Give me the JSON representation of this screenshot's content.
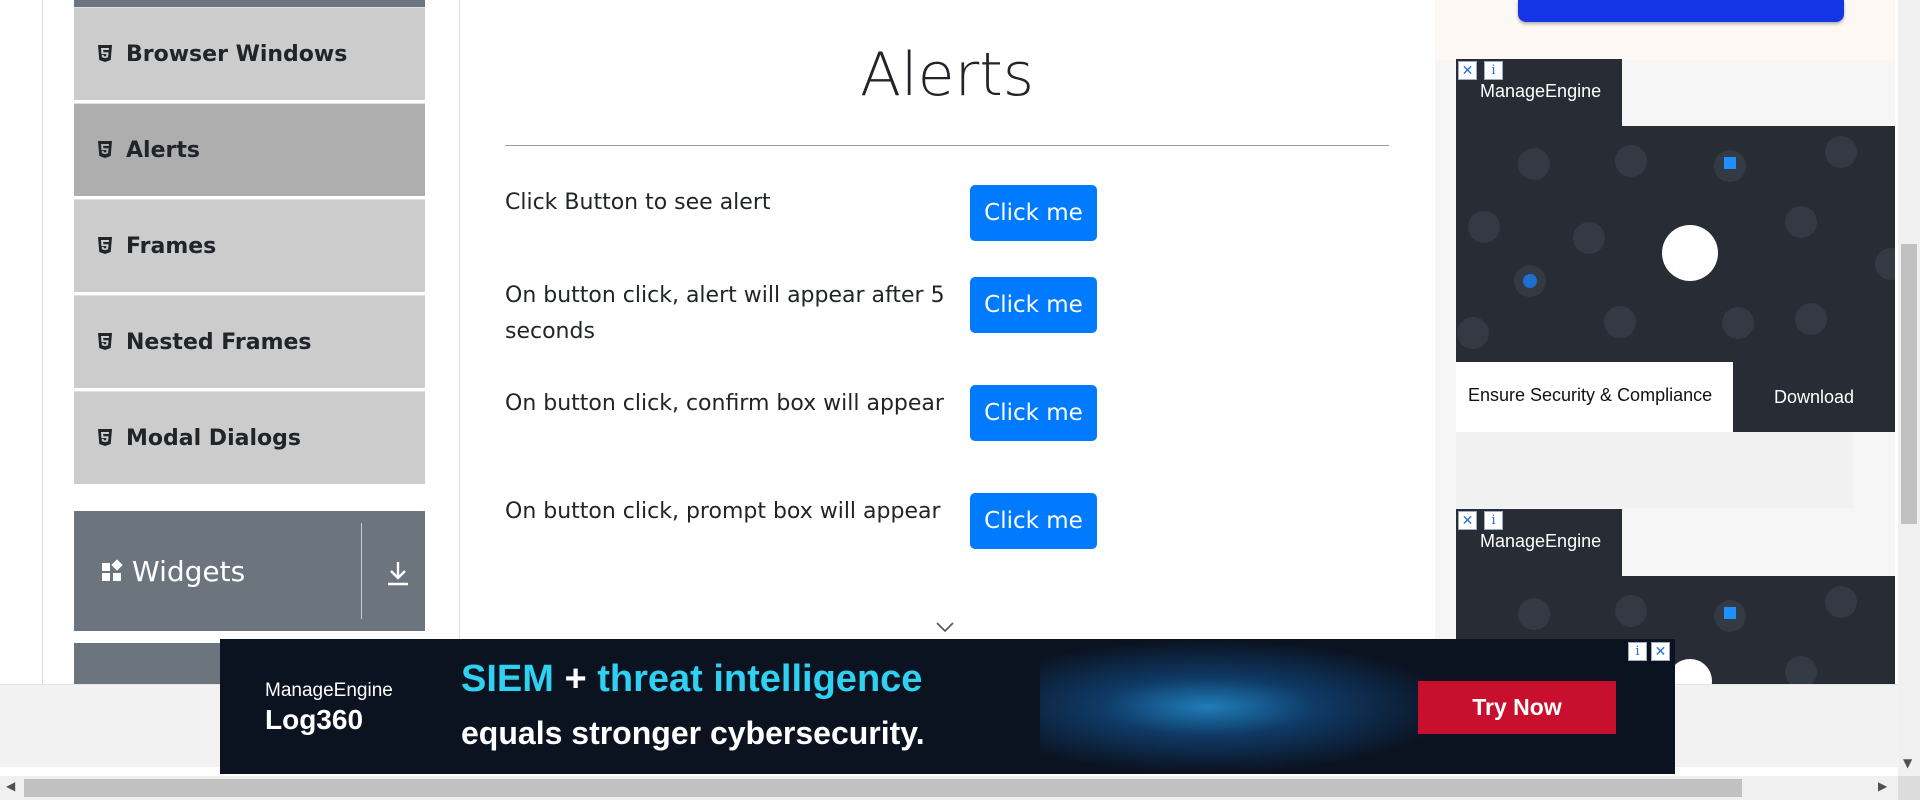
{
  "sidebar": {
    "items": [
      {
        "label": "Browser Windows",
        "icon": "html5-icon",
        "active": false
      },
      {
        "label": "Alerts",
        "icon": "html5-icon",
        "active": true
      },
      {
        "label": "Frames",
        "icon": "html5-icon",
        "active": false
      },
      {
        "label": "Nested Frames",
        "icon": "html5-icon",
        "active": false
      },
      {
        "label": "Modal Dialogs",
        "icon": "html5-icon",
        "active": false
      }
    ],
    "group": {
      "label": "Widgets",
      "icon": "widgets-grid-icon",
      "toggle_icon": "download-arrow-icon"
    }
  },
  "main": {
    "title": "Alerts",
    "rows": [
      {
        "text": "Click Button to see alert",
        "button": "Click me"
      },
      {
        "text": "On button click, alert will appear after 5 seconds",
        "button": "Click me"
      },
      {
        "text": "On button click, confirm box will appear",
        "button": "Click me"
      },
      {
        "text": "On button click, prompt box will appear",
        "button": "Click me"
      }
    ]
  },
  "right_ads": {
    "ad1": {
      "brand": "ManageEngine",
      "tagline": "Ensure Security & Compliance",
      "cta": "Download",
      "close": "✕",
      "info": "i"
    },
    "ad2": {
      "brand": "ManageEngine",
      "close": "✕",
      "info": "i"
    }
  },
  "bottom_ad": {
    "brand": "ManageEngine",
    "product": "Log360",
    "headline_part1": "SIEM",
    "headline_plus": "+",
    "headline_part2": "threat intelligence",
    "subline": "equals stronger cybersecurity.",
    "cta": "Try Now",
    "close": "✕",
    "info": "i"
  },
  "colors": {
    "primary_button": "#007bff",
    "sidebar_item": "#cccccc",
    "sidebar_active": "#aeaeae",
    "group_header": "#6c757d",
    "cyan_text": "#2fd0f0",
    "cta_red": "#c8102e"
  }
}
